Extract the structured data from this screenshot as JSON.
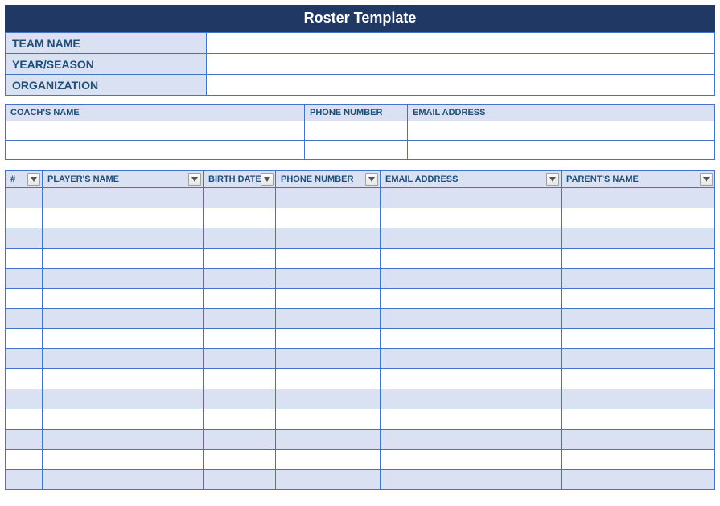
{
  "title": "Roster Template",
  "info": {
    "team_name_label": "TEAM NAME",
    "team_name_value": "",
    "year_season_label": "YEAR/SEASON",
    "year_season_value": "",
    "organization_label": "ORGANIZATION",
    "organization_value": ""
  },
  "coach": {
    "headers": {
      "name": "COACH'S NAME",
      "phone": "PHONE NUMBER",
      "email": "EMAIL ADDRESS"
    },
    "rows": [
      {
        "name": "",
        "phone": "",
        "email": ""
      },
      {
        "name": "",
        "phone": "",
        "email": ""
      }
    ]
  },
  "players": {
    "headers": {
      "num": "#",
      "name": "PLAYER'S NAME",
      "birth": "BIRTH DATE",
      "phone": "PHONE NUMBER",
      "email": "EMAIL ADDRESS",
      "parent": "PARENT'S NAME"
    },
    "rows": [
      {
        "num": "",
        "name": "",
        "birth": "",
        "phone": "",
        "email": "",
        "parent": ""
      },
      {
        "num": "",
        "name": "",
        "birth": "",
        "phone": "",
        "email": "",
        "parent": ""
      },
      {
        "num": "",
        "name": "",
        "birth": "",
        "phone": "",
        "email": "",
        "parent": ""
      },
      {
        "num": "",
        "name": "",
        "birth": "",
        "phone": "",
        "email": "",
        "parent": ""
      },
      {
        "num": "",
        "name": "",
        "birth": "",
        "phone": "",
        "email": "",
        "parent": ""
      },
      {
        "num": "",
        "name": "",
        "birth": "",
        "phone": "",
        "email": "",
        "parent": ""
      },
      {
        "num": "",
        "name": "",
        "birth": "",
        "phone": "",
        "email": "",
        "parent": ""
      },
      {
        "num": "",
        "name": "",
        "birth": "",
        "phone": "",
        "email": "",
        "parent": ""
      },
      {
        "num": "",
        "name": "",
        "birth": "",
        "phone": "",
        "email": "",
        "parent": ""
      },
      {
        "num": "",
        "name": "",
        "birth": "",
        "phone": "",
        "email": "",
        "parent": ""
      },
      {
        "num": "",
        "name": "",
        "birth": "",
        "phone": "",
        "email": "",
        "parent": ""
      },
      {
        "num": "",
        "name": "",
        "birth": "",
        "phone": "",
        "email": "",
        "parent": ""
      },
      {
        "num": "",
        "name": "",
        "birth": "",
        "phone": "",
        "email": "",
        "parent": ""
      },
      {
        "num": "",
        "name": "",
        "birth": "",
        "phone": "",
        "email": "",
        "parent": ""
      },
      {
        "num": "",
        "name": "",
        "birth": "",
        "phone": "",
        "email": "",
        "parent": ""
      }
    ]
  }
}
